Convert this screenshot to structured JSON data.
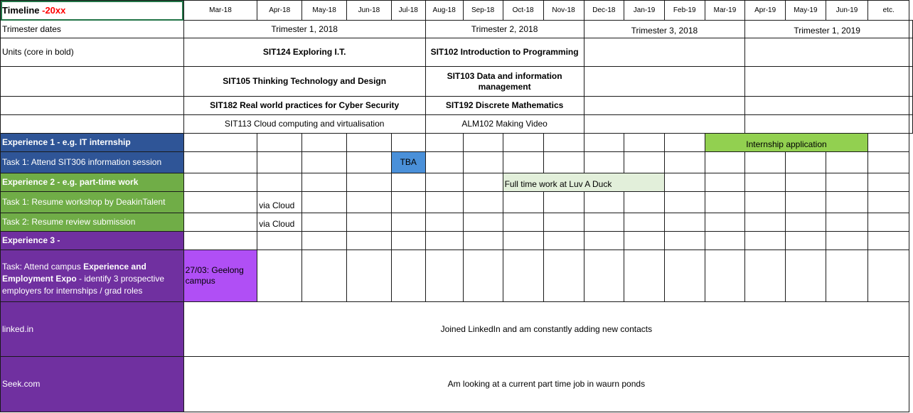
{
  "header": {
    "title": "Timeline ",
    "title_year": "-20xx",
    "months": [
      "Mar-18",
      "Apr-18",
      "May-18",
      "Jun-18",
      "Jul-18",
      "Aug-18",
      "Sep-18",
      "Oct-18",
      "Nov-18",
      "Dec-18",
      "Jan-19",
      "Feb-19",
      "Mar-19",
      "Apr-19",
      "May-19",
      "Jun-19",
      "etc."
    ]
  },
  "trimesters": {
    "label": "Trimester dates",
    "t1": "Trimester 1, 2018",
    "t2": "Trimester 2, 2018",
    "t3": "Trimester 3, 2018",
    "t4": "Trimester 1, 2019"
  },
  "units": {
    "label": "Units (core in bold)",
    "rows": [
      [
        "SIT124 Exploring I.T.",
        "SIT102 Introduction to Programming"
      ],
      [
        "SIT105 Thinking Technology and Design",
        "SIT103 Data and information management"
      ],
      [
        "SIT182 Real world practices for Cyber Security",
        "SIT192 Discrete Mathematics"
      ],
      [
        "SIT113 Cloud computing and virtualisation",
        "ALM102 Making Video"
      ]
    ]
  },
  "exp1": {
    "label": "Experience 1 - e.g. IT internship",
    "bar": "Internship application",
    "task1": "Task 1: Attend SIT306 information session",
    "task1_cell": "TBA"
  },
  "exp2": {
    "label": "Experience 2 - e.g. part-time work",
    "bar": "Full time work at Luv A Duck",
    "task1": "Task 1: Resume workshop by DeakinTalent",
    "task1_cell": "via Cloud",
    "task2": "Task 2: Resume review submission",
    "task2_cell": "via Cloud"
  },
  "exp3": {
    "label": "Experience 3 -",
    "task_pre": "Task: Attend campus ",
    "task_bold": "Experience and Employment Expo",
    "task_post": " - identify 3 prospective employers for internships / grad roles",
    "task_cell": "27/03: Geelong campus"
  },
  "linkedin": {
    "label": "linked.in",
    "text": "Joined LinkedIn and am constantly adding new contacts"
  },
  "seek": {
    "label": "Seek.com",
    "text": "Am looking at a current part time job in waurn ponds"
  }
}
